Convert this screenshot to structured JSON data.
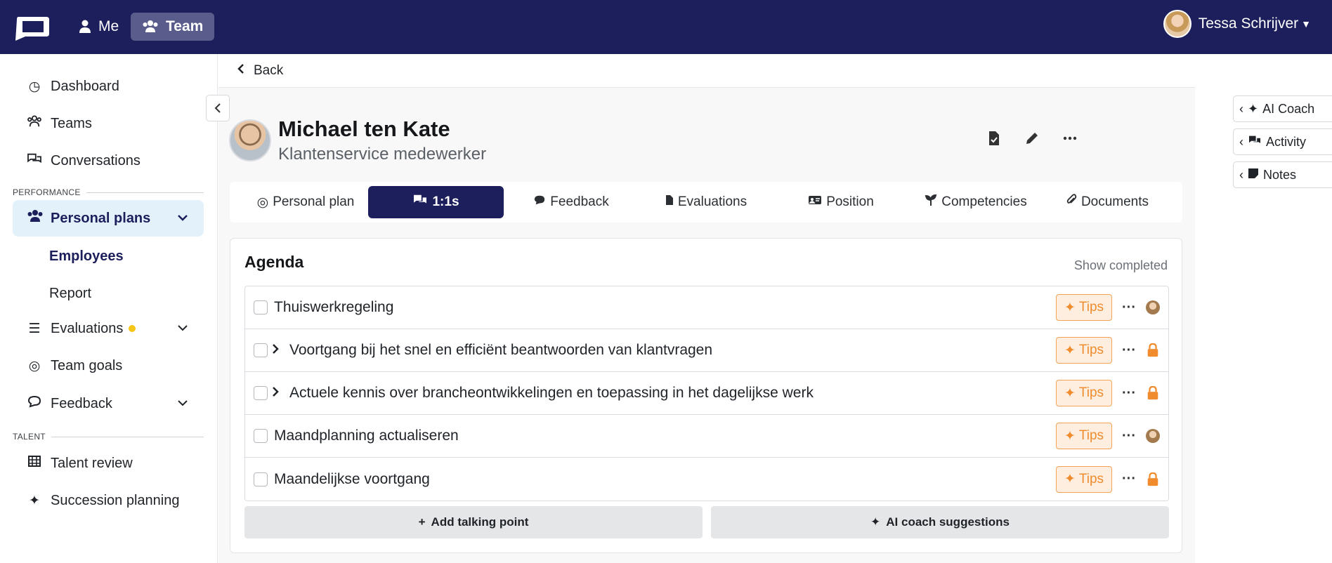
{
  "topbar": {
    "nav": [
      {
        "label": "Me",
        "icon": "user-icon"
      },
      {
        "label": "Team",
        "icon": "users-icon"
      }
    ],
    "user_name": "Tessa Schrijver",
    "brand_color": "#1d1f5c"
  },
  "sidebar": {
    "items": [
      {
        "label": "Dashboard"
      },
      {
        "label": "Teams"
      },
      {
        "label": "Conversations"
      }
    ],
    "section_performance": "PERFORMANCE",
    "personal_plans": "Personal plans",
    "sub_employees": "Employees",
    "sub_report": "Report",
    "evaluations": "Evaluations",
    "team_goals": "Team goals",
    "feedback": "Feedback",
    "section_talent": "TALENT",
    "talent_review": "Talent review",
    "succession_planning": "Succession planning"
  },
  "main": {
    "back_label": "Back",
    "profile": {
      "name": "Michael ten Kate",
      "role": "Klantenservice medewerker"
    },
    "tabs": [
      {
        "label": "Personal plan"
      },
      {
        "label": "1:1s"
      },
      {
        "label": "Feedback"
      },
      {
        "label": "Evaluations"
      },
      {
        "label": "Position"
      },
      {
        "label": "Competencies"
      },
      {
        "label": "Documents"
      }
    ],
    "agenda": {
      "title": "Agenda",
      "show_completed": "Show completed",
      "tips_label": "Tips",
      "items": [
        {
          "text": "Thuiswerkregeling"
        },
        {
          "text": "Voortgang bij het snel en efficiënt beantwoorden van klantvragen"
        },
        {
          "text": "Actuele kennis over brancheontwikkelingen en toepassing in het dagelijkse werk"
        },
        {
          "text": "Maandplanning actualiseren"
        },
        {
          "text": "Maandelijkse voortgang"
        }
      ],
      "add_talking_point": "Add talking point",
      "ai_coach_suggestions": "AI coach suggestions"
    }
  },
  "side_panel": {
    "ai_coach": "AI Coach",
    "activity": "Activity",
    "notes": "Notes"
  },
  "colors": {
    "accent_orange": "#f08c2e",
    "active_nav_bg": "#e3f1fb"
  }
}
